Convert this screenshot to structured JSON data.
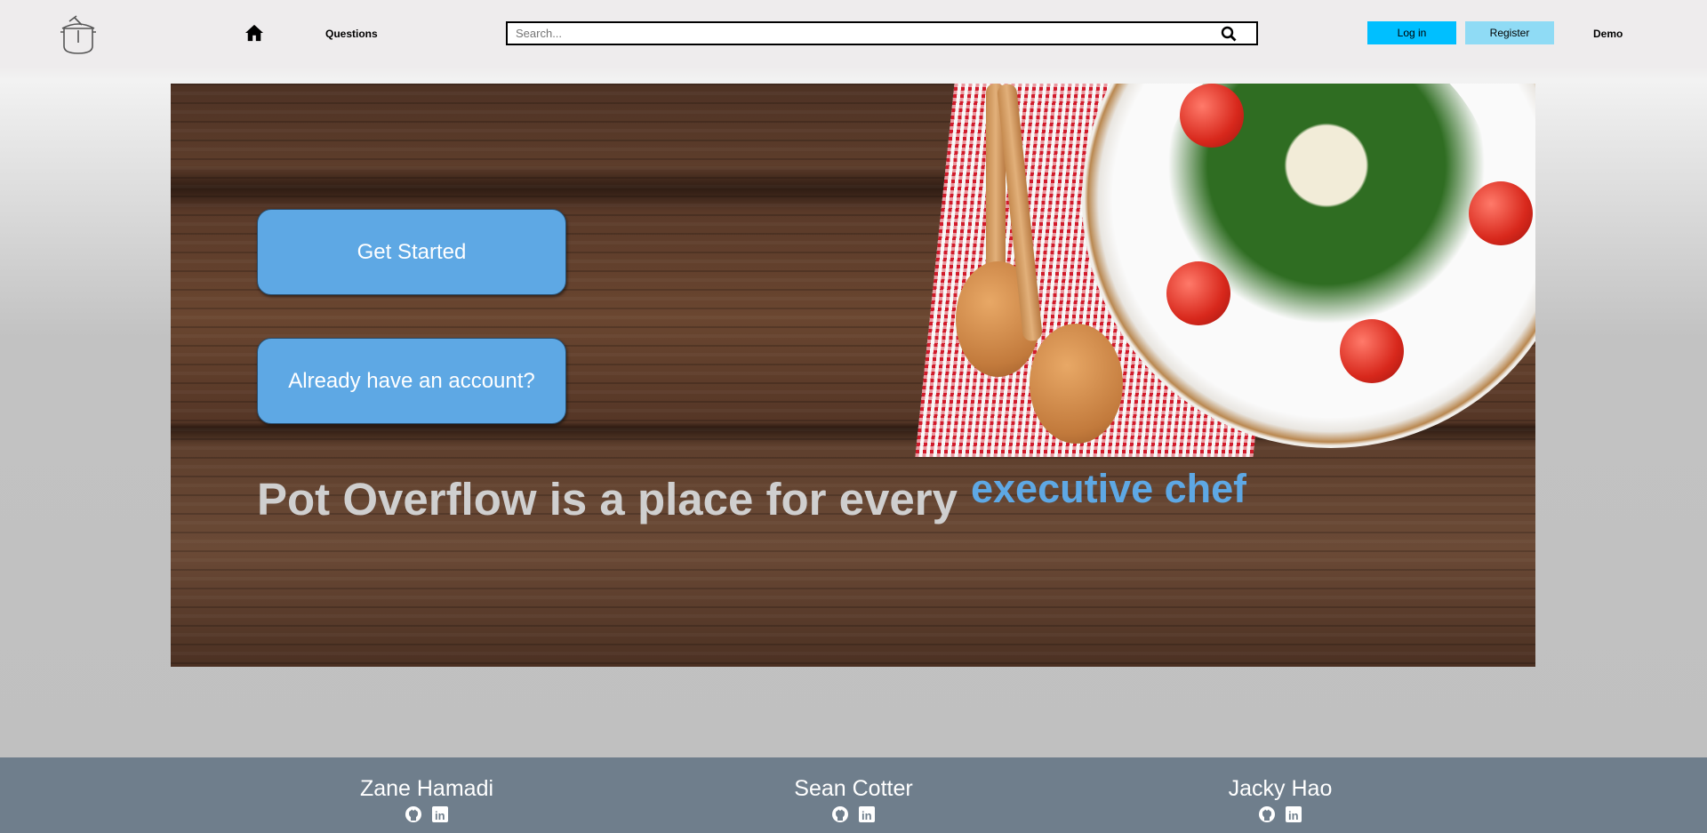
{
  "nav": {
    "questions": "Questions",
    "search_placeholder": "Search...",
    "login": "Log in",
    "register": "Register",
    "demo": "Demo"
  },
  "hero": {
    "get_started": "Get Started",
    "have_account": "Already have an account?",
    "tagline": "Pot Overflow is a place for every",
    "rotating_word": "executive chef"
  },
  "footer": {
    "people": [
      {
        "name": "Zane Hamadi"
      },
      {
        "name": "Sean Cotter"
      },
      {
        "name": "Jacky Hao"
      }
    ]
  },
  "colors": {
    "login": "#00bfff",
    "register": "#8fdbf5",
    "cta": "#5ea8e4",
    "footer": "#6f7e8c"
  }
}
